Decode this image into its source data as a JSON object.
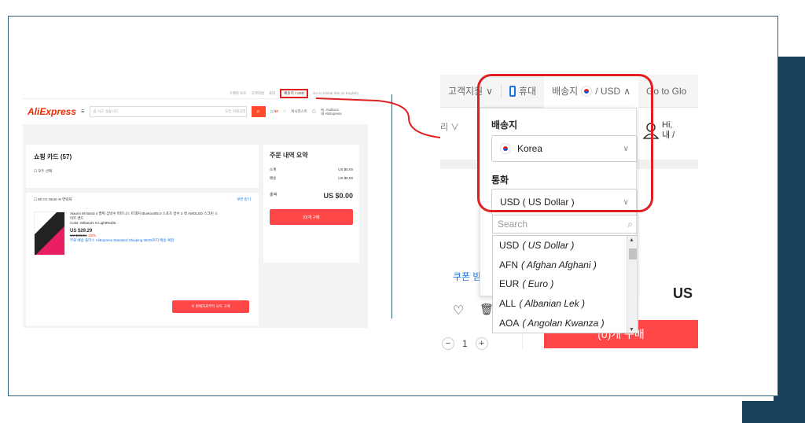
{
  "colors": {
    "accent": "#e02020",
    "brand": "#ff4747",
    "frame": "#17405c",
    "link": "#1a73e8"
  },
  "mini": {
    "topbar": [
      "구매자 보호",
      "고객지원",
      "휴대",
      "배송지 / USD",
      "Go to Global Site (in English)"
    ],
    "logo": "AliExpress",
    "search_placeholder": "숍 사고 싶습니다",
    "search_scope": "모든 카테고리",
    "cart_count": "57",
    "wishlist": "위시리스트",
    "greeting": "Hi, Audiooo",
    "myali": "내 AliExpress",
    "cart_title": "쇼핑 카드 (57)",
    "select_all": "모두 선택",
    "store_name": "Mi CC Store",
    "store_contact": "연락처",
    "coupon": "쿠폰 받기",
    "item_title": "Xiaomi Mi Band 4 팔찌 심박수 피트니스 트래커 Bluetooth5.0 스포츠 방수 3 색 AMOLED 스크린 스마트 밴드",
    "item_color": "Color: Miband4 N LightRedSt",
    "item_price": "US $29.29",
    "item_old_price": "US $43.04",
    "item_discount": "-32%",
    "shipping": "무료 배송 플러스 AliExpress Standard Shipping 06/25까지 배송 예정",
    "buy_from_seller": "이 판매자로부터 모두 구매",
    "summary_title": "주문 내역 요약",
    "subtotal_label": "소계",
    "subtotal_value": "US $0.00",
    "shipping_label": "배송",
    "shipping_value": "US $0.00",
    "total_label": "총액",
    "total_value": "US $0.00",
    "buy_button": "(0)개 구매"
  },
  "zoom": {
    "nav_customer": "고객지원",
    "nav_mobile": "휴대",
    "nav_shipto": "배송지",
    "nav_currency": "/ USD",
    "nav_global": "Go to Glo",
    "lang_fragment": "리",
    "hi": "Hi,",
    "my": "내 /",
    "coupon": "쿠폰 받기",
    "us": "US",
    "qty": "1",
    "buy_button": "(0)개 구매",
    "shipto_label": "배송지",
    "country": "Korea",
    "currency_label": "통화",
    "currency_selected": "USD ( US Dollar )",
    "search_placeholder": "Search",
    "currency_options": [
      {
        "code": "USD",
        "name": "( US Dollar )"
      },
      {
        "code": "AFN",
        "name": "( Afghan Afghani )"
      },
      {
        "code": "EUR",
        "name": "( Euro )"
      },
      {
        "code": "ALL",
        "name": "( Albanian Lek )"
      },
      {
        "code": "AOA",
        "name": "( Angolan Kwanza )"
      }
    ]
  }
}
